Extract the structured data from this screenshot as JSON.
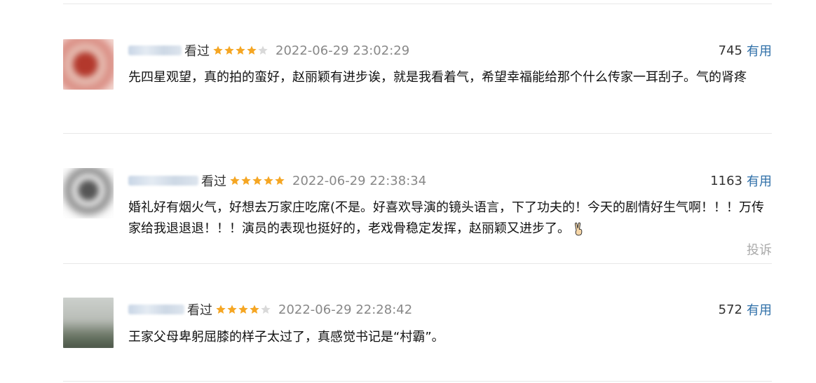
{
  "reviews": [
    {
      "watched_label": "看过",
      "rating": 4,
      "time": "2022-06-29 23:02:29",
      "votes": "745",
      "useful_label": "有用",
      "content": "先四星观望，真的拍的蛮好，赵丽颖有进步诶，就是我看着气，希望幸福能给那个什么传家一耳刮子。气的肾疼"
    },
    {
      "watched_label": "看过",
      "rating": 5,
      "time": "2022-06-29 22:38:34",
      "votes": "1163",
      "useful_label": "有用",
      "content": "婚礼好有烟火气，好想去万家庄吃席(不是。好喜欢导演的镜头语言，下了功夫的！今天的剧情好生气啊！！！万传家给我退退退！！！演员的表现也挺好的，老戏骨稳定发挥，赵丽颖又进步了。",
      "report_label": "投诉"
    },
    {
      "watched_label": "看过",
      "rating": 4,
      "time": "2022-06-29 22:28:42",
      "votes": "572",
      "useful_label": "有用",
      "content": "王家父母卑躬屈膝的样子太过了，真感觉书记是“村霸”。"
    }
  ],
  "colors": {
    "star_on": "#f5a623",
    "star_off": "#d9d9d9",
    "link": "#2f6fa8",
    "time": "#888888"
  }
}
